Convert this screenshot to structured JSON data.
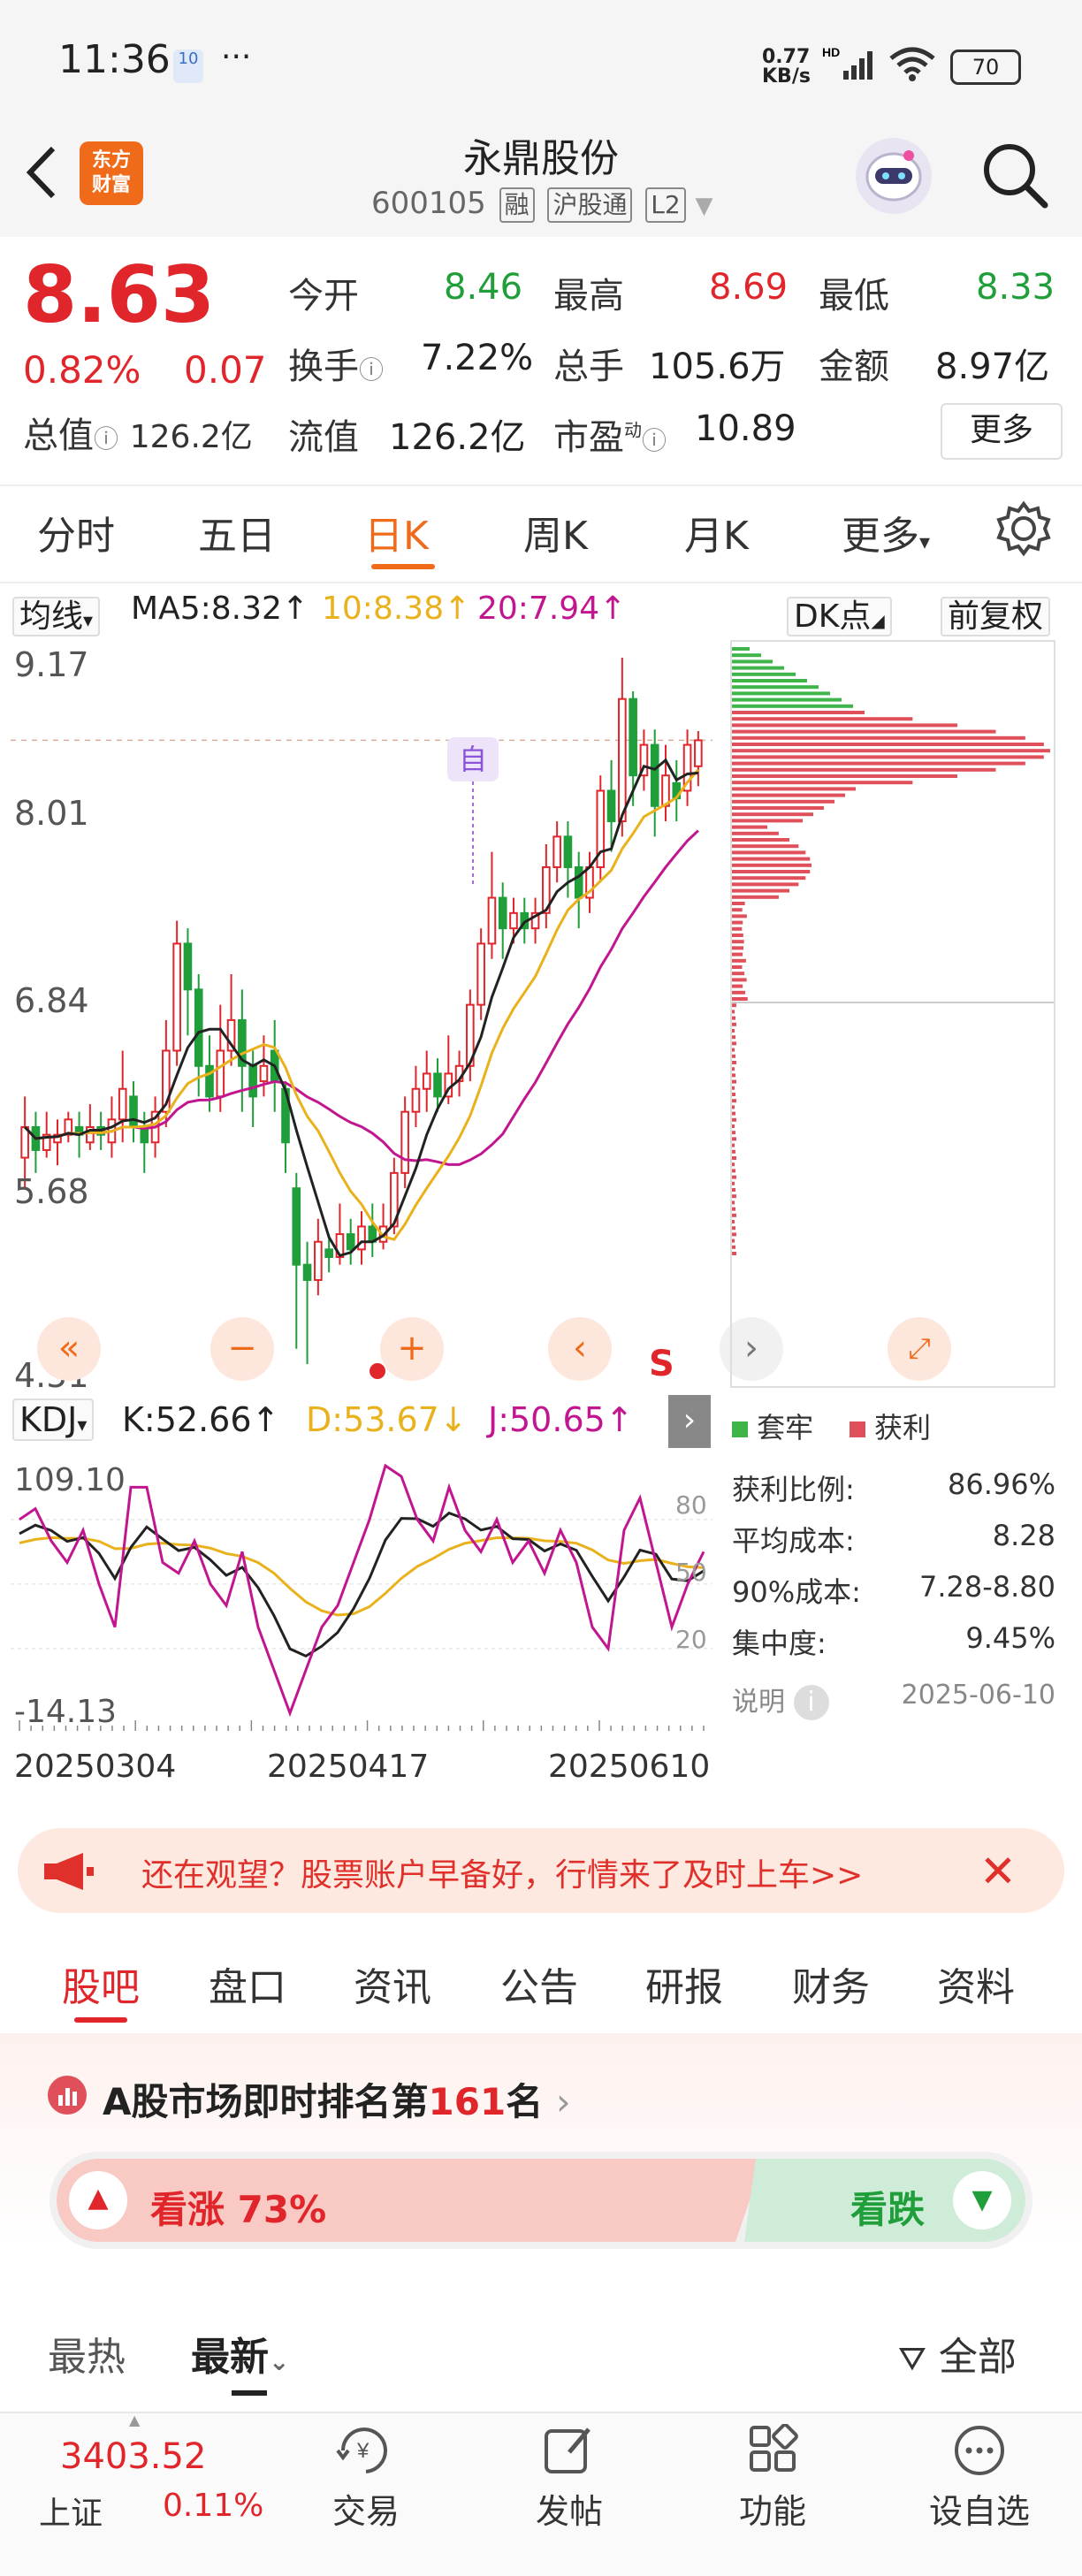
{
  "status_bar": {
    "time": "11:36",
    "net_speed_top": "0.77",
    "net_speed_bottom": "KB/s",
    "hd": "HD",
    "battery": "70",
    "notif_badge": "10",
    "dots": "···"
  },
  "header": {
    "logo_line1": "东方",
    "logo_line2": "财富",
    "title": "永鼎股份",
    "code": "600105",
    "tags": [
      "融",
      "沪股通",
      "L2"
    ]
  },
  "quote": {
    "price": "8.63",
    "change_pct": "0.82%",
    "change_amt": "0.07",
    "open_label": "今开",
    "open": "8.46",
    "high_label": "最高",
    "high": "8.69",
    "low_label": "最低",
    "low": "8.33",
    "turnover_label": "换手",
    "turnover": "7.22%",
    "volume_label": "总手",
    "volume": "105.6万",
    "amount_label": "金额",
    "amount": "8.97亿",
    "mktcap_label": "总值",
    "mktcap": "126.2亿",
    "float_label": "流值",
    "float_cap": "126.2亿",
    "pe_label": "市盈",
    "pe_sup": "动",
    "pe": "10.89",
    "more": "更多"
  },
  "period_tabs": [
    "分时",
    "五日",
    "日K",
    "周K",
    "月K",
    "更多"
  ],
  "ma_bar": {
    "selector": "均线",
    "ma5": "MA5:8.32",
    "ma10": "10:8.38",
    "ma20": "20:7.94",
    "dk": "DK点",
    "adjust": "前复权"
  },
  "kchart": {
    "y_labels": [
      "9.17",
      "8.01",
      "6.84",
      "5.68",
      "4.51"
    ],
    "marker_zi": "自",
    "marker_s": "S",
    "colors": {
      "up": "#e0252b",
      "down": "#1f9e3a",
      "ma5": "#222222",
      "ma10": "#e9b21c",
      "ma20": "#c1168f"
    }
  },
  "chart_data": {
    "type": "candlestick",
    "title": "",
    "ylim": [
      4.51,
      9.17
    ],
    "x_dates": [
      "20250304",
      "20250417",
      "20250610"
    ],
    "candles": [
      {
        "o": 5.9,
        "c": 6.1,
        "h": 6.3,
        "l": 5.7
      },
      {
        "o": 6.1,
        "c": 5.95,
        "h": 6.2,
        "l": 5.8
      },
      {
        "o": 5.95,
        "c": 6.05,
        "h": 6.2,
        "l": 5.9
      },
      {
        "o": 6.0,
        "c": 6.05,
        "h": 6.15,
        "l": 5.85
      },
      {
        "o": 6.05,
        "c": 6.15,
        "h": 6.2,
        "l": 6.0
      },
      {
        "o": 6.1,
        "c": 6.05,
        "h": 6.2,
        "l": 5.9
      },
      {
        "o": 6.0,
        "c": 6.1,
        "h": 6.25,
        "l": 5.95
      },
      {
        "o": 6.1,
        "c": 6.05,
        "h": 6.2,
        "l": 5.95
      },
      {
        "o": 6.0,
        "c": 6.15,
        "h": 6.3,
        "l": 5.9
      },
      {
        "o": 6.15,
        "c": 6.35,
        "h": 6.6,
        "l": 6.0
      },
      {
        "o": 6.3,
        "c": 6.1,
        "h": 6.4,
        "l": 6.0
      },
      {
        "o": 6.1,
        "c": 6.0,
        "h": 6.2,
        "l": 5.8
      },
      {
        "o": 6.0,
        "c": 6.2,
        "h": 6.3,
        "l": 5.9
      },
      {
        "o": 6.2,
        "c": 6.6,
        "h": 6.8,
        "l": 6.1
      },
      {
        "o": 6.6,
        "c": 7.3,
        "h": 7.45,
        "l": 6.5
      },
      {
        "o": 7.3,
        "c": 7.0,
        "h": 7.4,
        "l": 6.7
      },
      {
        "o": 7.0,
        "c": 6.5,
        "h": 7.1,
        "l": 6.3
      },
      {
        "o": 6.5,
        "c": 6.3,
        "h": 6.7,
        "l": 6.2
      },
      {
        "o": 6.3,
        "c": 6.6,
        "h": 6.9,
        "l": 6.2
      },
      {
        "o": 6.6,
        "c": 6.8,
        "h": 7.1,
        "l": 6.5
      },
      {
        "o": 6.8,
        "c": 6.5,
        "h": 7.0,
        "l": 6.2
      },
      {
        "o": 6.5,
        "c": 6.3,
        "h": 6.6,
        "l": 6.1
      },
      {
        "o": 6.4,
        "c": 6.5,
        "h": 6.7,
        "l": 6.3
      },
      {
        "o": 6.6,
        "c": 6.4,
        "h": 6.8,
        "l": 6.2
      },
      {
        "o": 6.35,
        "c": 6.0,
        "h": 6.4,
        "l": 5.8
      },
      {
        "o": 5.7,
        "c": 5.2,
        "h": 5.8,
        "l": 4.65
      },
      {
        "o": 5.2,
        "c": 5.1,
        "h": 5.35,
        "l": 4.55
      },
      {
        "o": 5.1,
        "c": 5.35,
        "h": 5.5,
        "l": 5.0
      },
      {
        "o": 5.3,
        "c": 5.25,
        "h": 5.4,
        "l": 5.15
      },
      {
        "o": 5.25,
        "c": 5.4,
        "h": 5.6,
        "l": 5.2
      },
      {
        "o": 5.4,
        "c": 5.3,
        "h": 5.5,
        "l": 5.2
      },
      {
        "o": 5.3,
        "c": 5.45,
        "h": 5.55,
        "l": 5.2
      },
      {
        "o": 5.45,
        "c": 5.35,
        "h": 5.6,
        "l": 5.25
      },
      {
        "o": 5.35,
        "c": 5.45,
        "h": 5.6,
        "l": 5.3
      },
      {
        "o": 5.45,
        "c": 5.8,
        "h": 5.9,
        "l": 5.4
      },
      {
        "o": 5.8,
        "c": 6.2,
        "h": 6.3,
        "l": 5.7
      },
      {
        "o": 6.2,
        "c": 6.35,
        "h": 6.5,
        "l": 6.1
      },
      {
        "o": 6.35,
        "c": 6.45,
        "h": 6.6,
        "l": 6.2
      },
      {
        "o": 6.45,
        "c": 6.3,
        "h": 6.55,
        "l": 6.2
      },
      {
        "o": 6.3,
        "c": 6.45,
        "h": 6.7,
        "l": 6.25
      },
      {
        "o": 6.4,
        "c": 6.5,
        "h": 6.6,
        "l": 6.3
      },
      {
        "o": 6.5,
        "c": 6.9,
        "h": 7.0,
        "l": 6.4
      },
      {
        "o": 6.9,
        "c": 7.3,
        "h": 7.4,
        "l": 6.8
      },
      {
        "o": 7.3,
        "c": 7.6,
        "h": 7.9,
        "l": 7.2
      },
      {
        "o": 7.6,
        "c": 7.4,
        "h": 7.7,
        "l": 7.2
      },
      {
        "o": 7.4,
        "c": 7.5,
        "h": 7.6,
        "l": 7.3
      },
      {
        "o": 7.5,
        "c": 7.4,
        "h": 7.6,
        "l": 7.3
      },
      {
        "o": 7.4,
        "c": 7.5,
        "h": 7.6,
        "l": 7.3
      },
      {
        "o": 7.5,
        "c": 7.8,
        "h": 7.95,
        "l": 7.4
      },
      {
        "o": 7.8,
        "c": 8.0,
        "h": 8.1,
        "l": 7.7
      },
      {
        "o": 8.0,
        "c": 7.8,
        "h": 8.1,
        "l": 7.6
      },
      {
        "o": 7.8,
        "c": 7.6,
        "h": 7.9,
        "l": 7.4
      },
      {
        "o": 7.6,
        "c": 7.8,
        "h": 7.9,
        "l": 7.5
      },
      {
        "o": 7.8,
        "c": 8.3,
        "h": 8.4,
        "l": 7.7
      },
      {
        "o": 8.3,
        "c": 8.1,
        "h": 8.5,
        "l": 7.9
      },
      {
        "o": 8.1,
        "c": 8.9,
        "h": 9.17,
        "l": 8.0
      },
      {
        "o": 8.9,
        "c": 8.4,
        "h": 8.95,
        "l": 8.2
      },
      {
        "o": 8.4,
        "c": 8.6,
        "h": 8.7,
        "l": 8.3
      },
      {
        "o": 8.6,
        "c": 8.2,
        "h": 8.7,
        "l": 8.0
      },
      {
        "o": 8.2,
        "c": 8.4,
        "h": 8.6,
        "l": 8.1
      },
      {
        "o": 8.35,
        "c": 8.25,
        "h": 8.5,
        "l": 8.1
      },
      {
        "o": 8.3,
        "c": 8.6,
        "h": 8.7,
        "l": 8.2
      },
      {
        "o": 8.46,
        "c": 8.63,
        "h": 8.69,
        "l": 8.33
      }
    ],
    "ma5_last": 8.32,
    "ma10_last": 8.38,
    "ma20_last": 7.94
  },
  "chip": {
    "legend_trapped": "套牢",
    "legend_profit": "获利",
    "rows": [
      {
        "label": "获利比例:",
        "value": "86.96%"
      },
      {
        "label": "平均成本:",
        "value": "8.28"
      },
      {
        "label": "90%成本:",
        "value": "7.28-8.80"
      },
      {
        "label": "集中度:",
        "value": "9.45%"
      }
    ],
    "note": "说明",
    "date": "2025-06-10"
  },
  "kdj": {
    "selector": "KDJ",
    "k": "K:52.66",
    "d": "D:53.67",
    "j": "J:50.65",
    "top": "109.10",
    "bottom": "-14.13",
    "r80": "80",
    "r50": "50",
    "r20": "20"
  },
  "dates": [
    "20250304",
    "20250417",
    "20250610"
  ],
  "banner": {
    "text": "还在观望？股票账户早备好，行情来了及时上车>>"
  },
  "content_tabs": [
    "股吧",
    "盘口",
    "资讯",
    "公告",
    "研报",
    "财务",
    "资料"
  ],
  "ranking": {
    "prefix": "A股市场即时排名第",
    "rank": "161",
    "suffix": "名"
  },
  "vote": {
    "up_label": "看涨",
    "up_pct": "73%",
    "down_label": "看跌"
  },
  "sort": {
    "hot": "最热",
    "latest": "最新",
    "filter": "全部"
  },
  "bottom_nav": {
    "index_value": "3403.52",
    "index_name": "上证",
    "index_pct": "0.11%",
    "items": [
      "交易",
      "发帖",
      "功能",
      "设自选"
    ]
  }
}
